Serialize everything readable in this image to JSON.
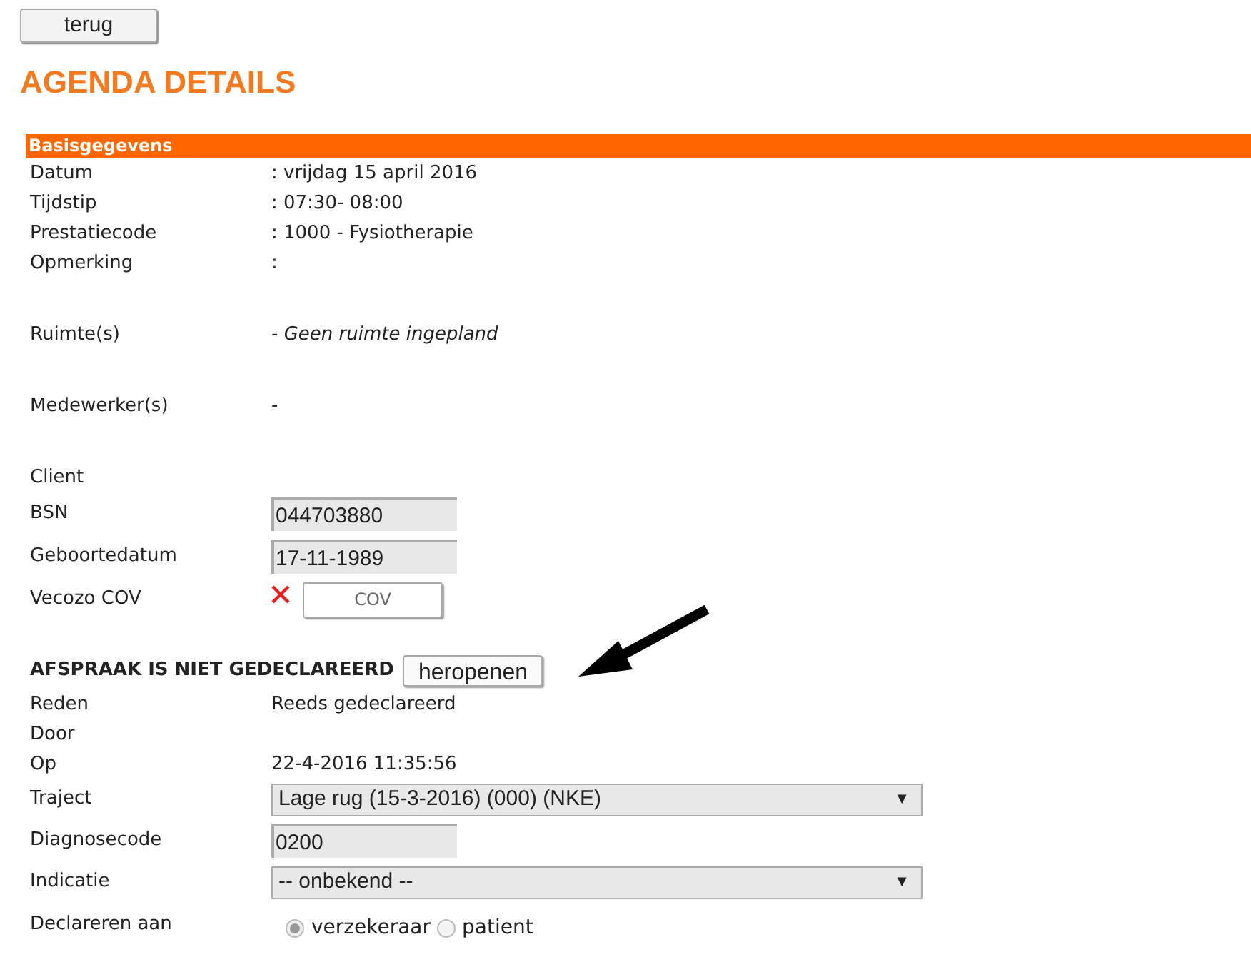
{
  "back_button": "terug",
  "title": "AGENDA DETAILS",
  "section_header": "Basisgegevens",
  "groups": [
    {
      "rows": [
        {
          "kind": "text",
          "label": "Datum",
          "value": ": vrijdag 15 april 2016"
        },
        {
          "kind": "text",
          "label": "Tijdstip",
          "value": ": 07:30- 08:00"
        },
        {
          "kind": "text",
          "label": "Prestatiecode",
          "value": ": 1000 - Fysiotherapie"
        },
        {
          "kind": "text",
          "label": "Opmerking",
          "value": ":"
        }
      ]
    },
    {
      "rows": [
        {
          "kind": "note",
          "label": "Ruimte(s)",
          "value": "- Geen ruimte ingepland"
        }
      ]
    },
    {
      "rows": [
        {
          "kind": "text",
          "label": "Medewerker(s)",
          "value": "-"
        }
      ]
    },
    {
      "rows": [
        {
          "kind": "label",
          "label": "Client"
        },
        {
          "kind": "input",
          "label": "BSN",
          "value": "044703880"
        },
        {
          "kind": "input",
          "label": "Geboortedatum",
          "value": "17-11-1989"
        },
        {
          "kind": "vecozo",
          "label": "Vecozo COV",
          "button": "COV",
          "valid": false
        }
      ]
    }
  ],
  "declaration": {
    "status": "AFSPRAAK IS NIET GEDECLAREERD",
    "button": "heropenen"
  },
  "details": [
    {
      "kind": "text",
      "label": "Reden",
      "value": "Reeds gedeclareerd"
    },
    {
      "kind": "label",
      "label": "Door"
    },
    {
      "kind": "text",
      "label": "Op",
      "value": "22-4-2016 11:35:56"
    },
    {
      "kind": "select",
      "label": "Traject",
      "value": "Lage rug (15-3-2016) (000) (NKE)",
      "arrow": "▼"
    },
    {
      "kind": "input",
      "label": "Diagnosecode",
      "value": "0200"
    },
    {
      "kind": "select",
      "label": "Indicatie",
      "value": "-- onbekend --",
      "arrow": "▼"
    },
    {
      "kind": "radio",
      "label": "Declareren aan",
      "options": [
        {
          "label": "verzekeraar",
          "selected": true
        },
        {
          "label": "patient",
          "selected": false
        }
      ]
    }
  ]
}
